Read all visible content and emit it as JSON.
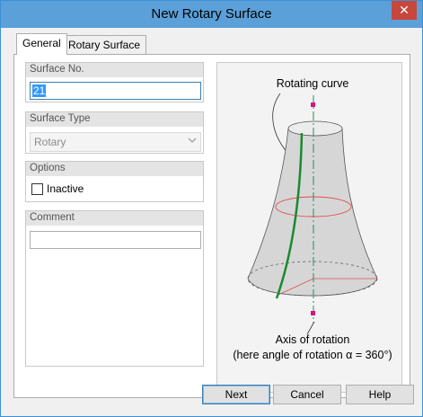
{
  "window": {
    "title": "New Rotary Surface",
    "close_glyph": "✕"
  },
  "tabs": [
    {
      "label": "General",
      "active": true
    },
    {
      "label": "Rotary Surface",
      "active": false
    }
  ],
  "surface_no": {
    "header": "Surface No.",
    "value": "21"
  },
  "surface_type": {
    "header": "Surface Type",
    "selected": "Rotary",
    "enabled": false,
    "arrow_icon": "chevron-down-icon"
  },
  "options": {
    "header": "Options",
    "inactive_label": "Inactive",
    "inactive_checked": false
  },
  "comment": {
    "header": "Comment",
    "value": ""
  },
  "illustration": {
    "rotating_curve_label": "Rotating curve",
    "axis_label": "Axis of rotation",
    "angle_label": "(here angle of rotation α = 360°)",
    "colors": {
      "curve": "#1a8a2e",
      "axis": "#2e8b57",
      "marker": "#e0107a",
      "rotation_circle": "#e05050"
    }
  },
  "buttons": {
    "next": "Next",
    "cancel": "Cancel",
    "help": "Help"
  },
  "colors": {
    "titlebar": "#5ba0d8",
    "close": "#c7473b",
    "selection": "#3399ff"
  }
}
